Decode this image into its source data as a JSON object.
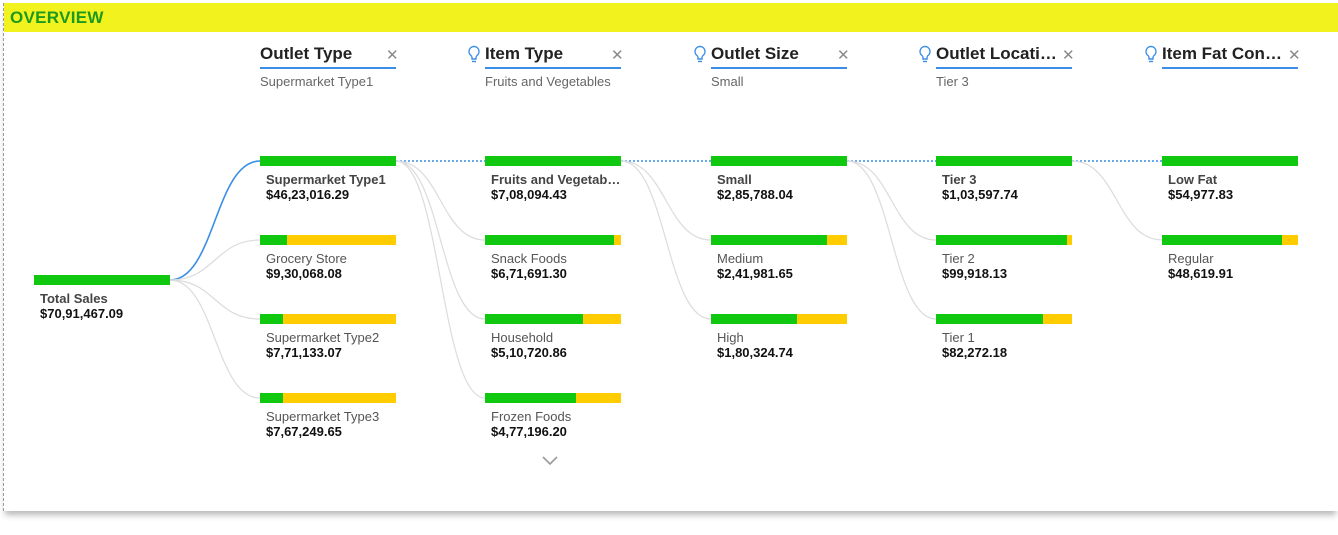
{
  "banner": {
    "title": "OVERVIEW"
  },
  "colors": {
    "banner": "#f2f21e",
    "title": "#1d9a1d",
    "bar_fill": "#11c811",
    "bar_rest": "#ffcc00",
    "link": "#3a8ee6"
  },
  "root": {
    "label": "Total Sales",
    "value": "$70,91,467.09",
    "share": 1.0
  },
  "levels": [
    {
      "title": "Outlet Type",
      "selected": "Supermarket Type1",
      "bulb": false,
      "nodes": [
        {
          "label": "Supermarket Type1",
          "value": "$46,23,016.29",
          "share": 1.0,
          "selected": true
        },
        {
          "label": "Grocery Store",
          "value": "$9,30,068.08",
          "share": 0.2
        },
        {
          "label": "Supermarket Type2",
          "value": "$7,71,133.07",
          "share": 0.17
        },
        {
          "label": "Supermarket Type3",
          "value": "$7,67,249.65",
          "share": 0.17
        }
      ]
    },
    {
      "title": "Item Type",
      "selected": "Fruits and Vegetables",
      "bulb": true,
      "nodes": [
        {
          "label": "Fruits and Vegetables",
          "value": "$7,08,094.43",
          "share": 1.0,
          "selected": true
        },
        {
          "label": "Snack Foods",
          "value": "$6,71,691.30",
          "share": 0.95
        },
        {
          "label": "Household",
          "value": "$5,10,720.86",
          "share": 0.72
        },
        {
          "label": "Frozen Foods",
          "value": "$4,77,196.20",
          "share": 0.67
        }
      ]
    },
    {
      "title": "Outlet Size",
      "selected": "Small",
      "bulb": true,
      "nodes": [
        {
          "label": "Small",
          "value": "$2,85,788.04",
          "share": 1.0,
          "selected": true
        },
        {
          "label": "Medium",
          "value": "$2,41,981.65",
          "share": 0.85
        },
        {
          "label": "High",
          "value": "$1,80,324.74",
          "share": 0.63
        }
      ]
    },
    {
      "title": "Outlet Location Type",
      "selected": "Tier 3",
      "bulb": true,
      "nodes": [
        {
          "label": "Tier 3",
          "value": "$1,03,597.74",
          "share": 1.0,
          "selected": true
        },
        {
          "label": "Tier 2",
          "value": "$99,918.13",
          "share": 0.965
        },
        {
          "label": "Tier 1",
          "value": "$82,272.18",
          "share": 0.79
        }
      ]
    },
    {
      "title": "Item Fat Content",
      "selected": "",
      "bulb": true,
      "nodes": [
        {
          "label": "Low Fat",
          "value": "$54,977.83",
          "share": 1.0,
          "selected": true
        },
        {
          "label": "Regular",
          "value": "$48,619.91",
          "share": 0.88
        }
      ]
    }
  ]
}
